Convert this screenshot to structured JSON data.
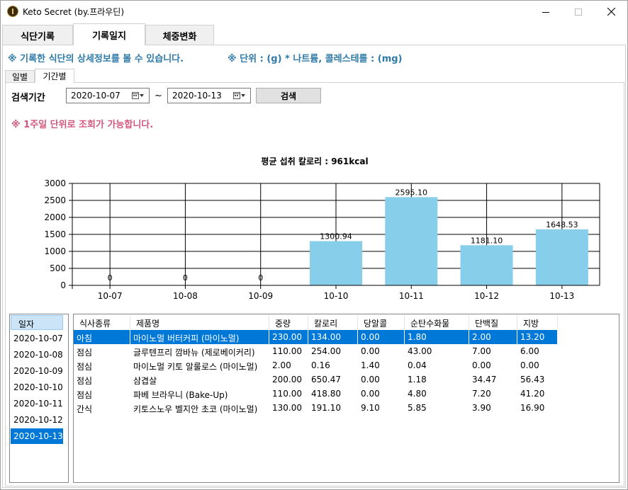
{
  "window": {
    "title": "Keto Secret (by.프라우딘)"
  },
  "main_tabs": [
    {
      "label": "식단기록"
    },
    {
      "label": "기록일지"
    },
    {
      "label": "체중변화"
    }
  ],
  "info": {
    "detail_notice": "※ 기록한 식단의 상세정보를 볼 수 있습니다.",
    "unit_notice": "※ 단위 : (g)  * 나트륨, 콜레스테롤 : (mg)"
  },
  "sub_tabs": [
    {
      "label": "일별"
    },
    {
      "label": "기간별"
    }
  ],
  "search": {
    "label": "검색기간",
    "start_date": "2020-10-07",
    "tilde": "~",
    "end_date": "2020-10-13",
    "button_label": "검색",
    "notice": "※ 1주일 단위로 조회가 가능합니다."
  },
  "colors": {
    "bar": "#87ceeb",
    "selected": "#0078d7",
    "info_text": "#2f7aa8",
    "notice_text": "#d2577d"
  },
  "chart_data": {
    "type": "bar",
    "title": "평균 섭취 칼로리 : 961kcal",
    "categories": [
      "10-07",
      "10-08",
      "10-09",
      "10-10",
      "10-11",
      "10-12",
      "10-13"
    ],
    "values": [
      0,
      0,
      0,
      1300.94,
      2595.1,
      1181.1,
      1648.53
    ],
    "data_labels": [
      "0",
      "0",
      "0",
      "1300.94",
      "2595.10",
      "1181.10",
      "1648.53"
    ],
    "y_ticks": [
      "0",
      "500",
      "1000",
      "1500",
      "2000",
      "2500",
      "3000"
    ],
    "ylim": [
      0,
      3000
    ],
    "grid": true
  },
  "date_list": {
    "header": "일자",
    "items": [
      "2020-10-07",
      "2020-10-08",
      "2020-10-09",
      "2020-10-10",
      "2020-10-11",
      "2020-10-12",
      "2020-10-13"
    ],
    "selected": "2020-10-13"
  },
  "grid": {
    "columns": [
      "식사종류",
      "제품명",
      "중량",
      "칼로리",
      "당알콜",
      "순탄수화물",
      "단백질",
      "지방"
    ],
    "rows": [
      [
        "아침",
        "마이노멀 버터커피 (마이노멀)",
        "230.00",
        "134.00",
        "0.00",
        "1.80",
        "2.00",
        "13.20"
      ],
      [
        "점심",
        "글루텐프리 깜바뉴 (제로베이커리)",
        "110.00",
        "254.00",
        "0.00",
        "43.00",
        "7.00",
        "6.00"
      ],
      [
        "점심",
        "마이노멀 키토 알룰로스 (마이노멀)",
        "2.00",
        "0.16",
        "1.40",
        "0.04",
        "0.00",
        "0.00"
      ],
      [
        "점심",
        "삼겹살",
        "200.00",
        "650.47",
        "0.00",
        "1.18",
        "34.47",
        "56.43"
      ],
      [
        "점심",
        "파베 브라우니 (Bake-Up)",
        "110.00",
        "418.80",
        "0.00",
        "4.80",
        "7.20",
        "41.20"
      ],
      [
        "간식",
        "키토스노우 벨지안 초코 (마이노멀)",
        "130.00",
        "191.10",
        "9.10",
        "5.85",
        "3.90",
        "16.90"
      ]
    ]
  }
}
